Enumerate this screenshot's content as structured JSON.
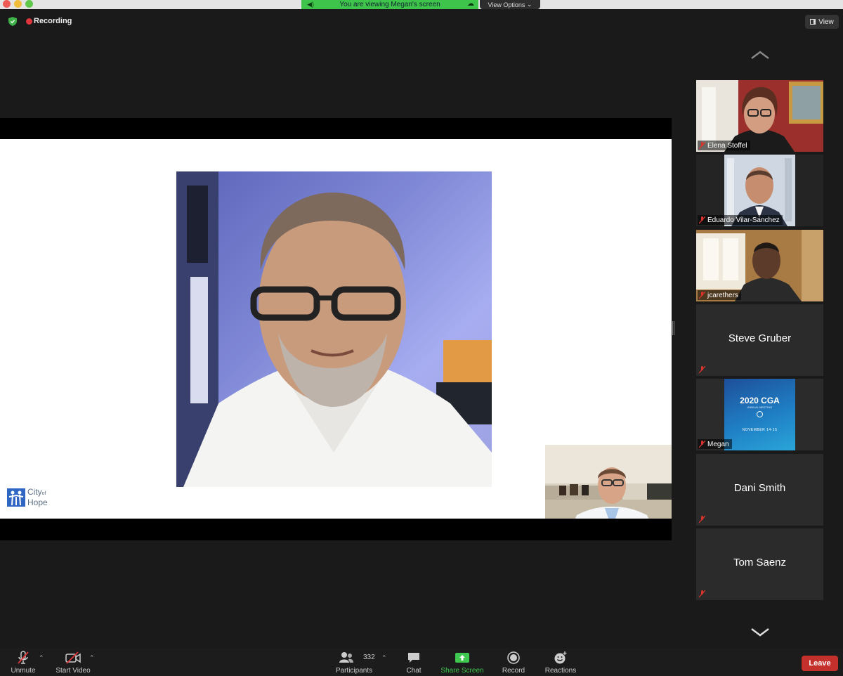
{
  "banner": {
    "viewing_text": "You are viewing Megan's screen",
    "view_options_label": "View Options"
  },
  "status": {
    "recording_label": "Recording",
    "view_label": "View"
  },
  "slide": {
    "logo_text_city": "City",
    "logo_text_of": "of",
    "logo_text_hope": "Hope"
  },
  "gallery": {
    "tiles": [
      {
        "name": "Elena Stoffel",
        "type": "video"
      },
      {
        "name": "Eduardo Vilar-Sanchez",
        "type": "video"
      },
      {
        "name": "jcarethers",
        "type": "video"
      },
      {
        "name": "Steve Gruber",
        "type": "name-only"
      },
      {
        "name": "Megan",
        "type": "image",
        "image_title": "2020 CGA",
        "image_subtitle": "ANNUAL MEETING",
        "image_date": "NOVEMBER 14-15"
      },
      {
        "name": "Dani Smith",
        "type": "name-only"
      },
      {
        "name": "Tom Saenz",
        "type": "name-only"
      }
    ]
  },
  "toolbar": {
    "unmute_label": "Unmute",
    "start_video_label": "Start Video",
    "participants_label": "Participants",
    "participants_count": "332",
    "chat_label": "Chat",
    "share_screen_label": "Share Screen",
    "record_label": "Record",
    "reactions_label": "Reactions",
    "leave_label": "Leave"
  },
  "colors": {
    "banner_green": "#3ec44a",
    "recording_red": "#e0353a",
    "leave_red": "#c4302b",
    "share_green": "#3fc84f"
  }
}
